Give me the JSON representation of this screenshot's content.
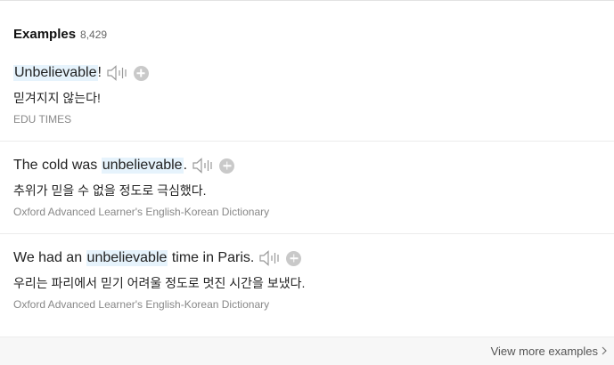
{
  "header": {
    "title": "Examples",
    "count": "8,429"
  },
  "examples": [
    {
      "en_before": "",
      "en_highlight": "Unbelievable",
      "en_after": "!",
      "ko": "믿겨지지 않는다!",
      "source": "EDU TIMES"
    },
    {
      "en_before": "The cold was ",
      "en_highlight": "unbelievable",
      "en_after": ".",
      "ko": "추위가 믿을 수 없을 정도로 극심했다.",
      "source": "Oxford Advanced Learner's English-Korean Dictionary"
    },
    {
      "en_before": "We had an ",
      "en_highlight": "unbelievable",
      "en_after": " time in Paris.",
      "ko": "우리는 파리에서 믿기 어려울 정도로 멋진 시간을 보냈다.",
      "source": "Oxford Advanced Learner's English-Korean Dictionary"
    }
  ],
  "footer": {
    "view_more_label": "View more examples"
  },
  "icons": {
    "speaker": "speaker-icon",
    "add": "plus-circle-icon",
    "chevron": "chevron-right-icon"
  },
  "colors": {
    "highlight": "#e6f3fc",
    "source_text": "#888888",
    "plus_button": "#c9c9c9"
  }
}
